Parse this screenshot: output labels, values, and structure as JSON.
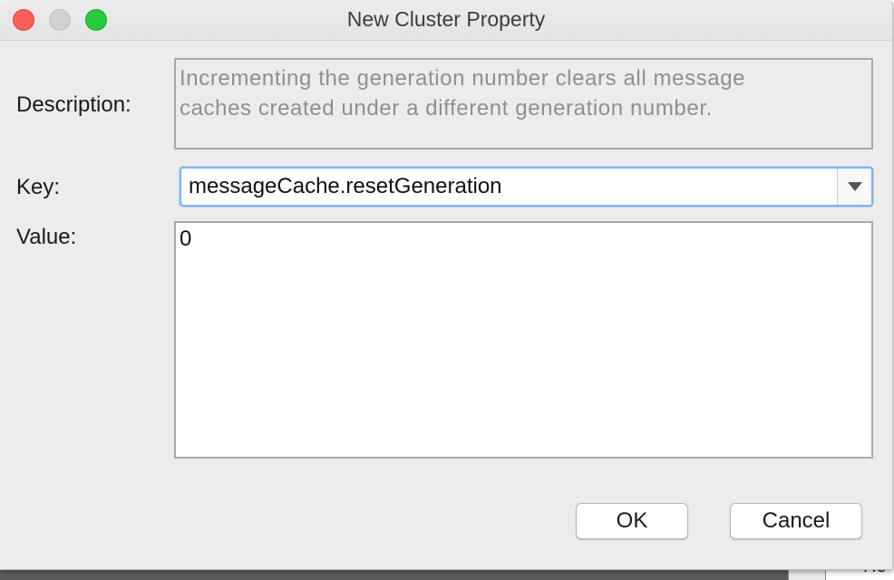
{
  "window": {
    "title": "New Cluster Property"
  },
  "form": {
    "description_label": "Description:",
    "description_text": "Incrementing the generation number clears all message\ncaches created under a different generation number.",
    "key_label": "Key:",
    "key_value": "messageCache.resetGeneration",
    "value_label": "Value:",
    "value_value": "0"
  },
  "buttons": {
    "ok_label": "OK",
    "cancel_label": "Cancel"
  },
  "background": {
    "partial_text": "He"
  },
  "colors": {
    "close": "#fc5f57",
    "minimize_inactive": "#d0d0d0",
    "maximize": "#29c940",
    "focus_ring": "#7fb2ec"
  }
}
